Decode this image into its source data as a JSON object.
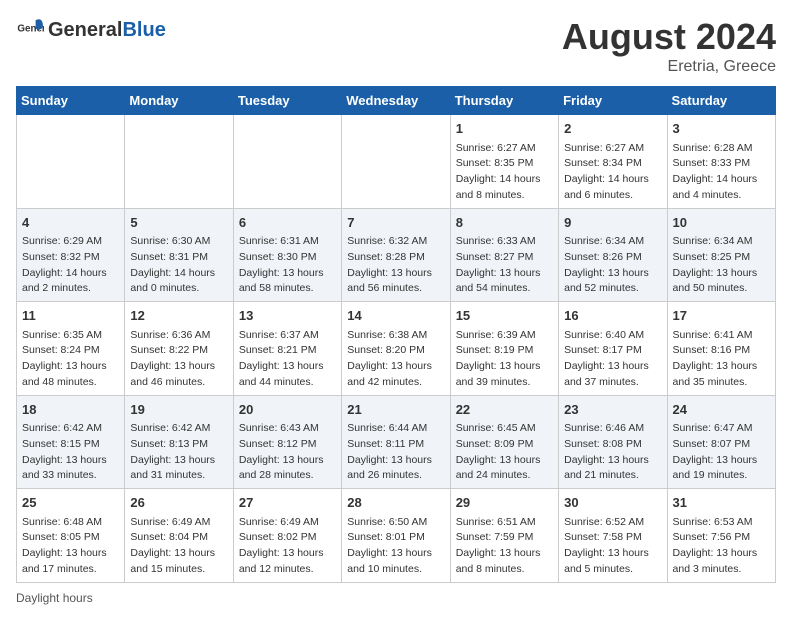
{
  "logo": {
    "general": "General",
    "blue": "Blue"
  },
  "title": "August 2024",
  "location": "Eretria, Greece",
  "days_of_week": [
    "Sunday",
    "Monday",
    "Tuesday",
    "Wednesday",
    "Thursday",
    "Friday",
    "Saturday"
  ],
  "weeks": [
    [
      {
        "day": "",
        "content": ""
      },
      {
        "day": "",
        "content": ""
      },
      {
        "day": "",
        "content": ""
      },
      {
        "day": "",
        "content": ""
      },
      {
        "day": "1",
        "content": "Sunrise: 6:27 AM\nSunset: 8:35 PM\nDaylight: 14 hours and 8 minutes."
      },
      {
        "day": "2",
        "content": "Sunrise: 6:27 AM\nSunset: 8:34 PM\nDaylight: 14 hours and 6 minutes."
      },
      {
        "day": "3",
        "content": "Sunrise: 6:28 AM\nSunset: 8:33 PM\nDaylight: 14 hours and 4 minutes."
      }
    ],
    [
      {
        "day": "4",
        "content": "Sunrise: 6:29 AM\nSunset: 8:32 PM\nDaylight: 14 hours and 2 minutes."
      },
      {
        "day": "5",
        "content": "Sunrise: 6:30 AM\nSunset: 8:31 PM\nDaylight: 14 hours and 0 minutes."
      },
      {
        "day": "6",
        "content": "Sunrise: 6:31 AM\nSunset: 8:30 PM\nDaylight: 13 hours and 58 minutes."
      },
      {
        "day": "7",
        "content": "Sunrise: 6:32 AM\nSunset: 8:28 PM\nDaylight: 13 hours and 56 minutes."
      },
      {
        "day": "8",
        "content": "Sunrise: 6:33 AM\nSunset: 8:27 PM\nDaylight: 13 hours and 54 minutes."
      },
      {
        "day": "9",
        "content": "Sunrise: 6:34 AM\nSunset: 8:26 PM\nDaylight: 13 hours and 52 minutes."
      },
      {
        "day": "10",
        "content": "Sunrise: 6:34 AM\nSunset: 8:25 PM\nDaylight: 13 hours and 50 minutes."
      }
    ],
    [
      {
        "day": "11",
        "content": "Sunrise: 6:35 AM\nSunset: 8:24 PM\nDaylight: 13 hours and 48 minutes."
      },
      {
        "day": "12",
        "content": "Sunrise: 6:36 AM\nSunset: 8:22 PM\nDaylight: 13 hours and 46 minutes."
      },
      {
        "day": "13",
        "content": "Sunrise: 6:37 AM\nSunset: 8:21 PM\nDaylight: 13 hours and 44 minutes."
      },
      {
        "day": "14",
        "content": "Sunrise: 6:38 AM\nSunset: 8:20 PM\nDaylight: 13 hours and 42 minutes."
      },
      {
        "day": "15",
        "content": "Sunrise: 6:39 AM\nSunset: 8:19 PM\nDaylight: 13 hours and 39 minutes."
      },
      {
        "day": "16",
        "content": "Sunrise: 6:40 AM\nSunset: 8:17 PM\nDaylight: 13 hours and 37 minutes."
      },
      {
        "day": "17",
        "content": "Sunrise: 6:41 AM\nSunset: 8:16 PM\nDaylight: 13 hours and 35 minutes."
      }
    ],
    [
      {
        "day": "18",
        "content": "Sunrise: 6:42 AM\nSunset: 8:15 PM\nDaylight: 13 hours and 33 minutes."
      },
      {
        "day": "19",
        "content": "Sunrise: 6:42 AM\nSunset: 8:13 PM\nDaylight: 13 hours and 31 minutes."
      },
      {
        "day": "20",
        "content": "Sunrise: 6:43 AM\nSunset: 8:12 PM\nDaylight: 13 hours and 28 minutes."
      },
      {
        "day": "21",
        "content": "Sunrise: 6:44 AM\nSunset: 8:11 PM\nDaylight: 13 hours and 26 minutes."
      },
      {
        "day": "22",
        "content": "Sunrise: 6:45 AM\nSunset: 8:09 PM\nDaylight: 13 hours and 24 minutes."
      },
      {
        "day": "23",
        "content": "Sunrise: 6:46 AM\nSunset: 8:08 PM\nDaylight: 13 hours and 21 minutes."
      },
      {
        "day": "24",
        "content": "Sunrise: 6:47 AM\nSunset: 8:07 PM\nDaylight: 13 hours and 19 minutes."
      }
    ],
    [
      {
        "day": "25",
        "content": "Sunrise: 6:48 AM\nSunset: 8:05 PM\nDaylight: 13 hours and 17 minutes."
      },
      {
        "day": "26",
        "content": "Sunrise: 6:49 AM\nSunset: 8:04 PM\nDaylight: 13 hours and 15 minutes."
      },
      {
        "day": "27",
        "content": "Sunrise: 6:49 AM\nSunset: 8:02 PM\nDaylight: 13 hours and 12 minutes."
      },
      {
        "day": "28",
        "content": "Sunrise: 6:50 AM\nSunset: 8:01 PM\nDaylight: 13 hours and 10 minutes."
      },
      {
        "day": "29",
        "content": "Sunrise: 6:51 AM\nSunset: 7:59 PM\nDaylight: 13 hours and 8 minutes."
      },
      {
        "day": "30",
        "content": "Sunrise: 6:52 AM\nSunset: 7:58 PM\nDaylight: 13 hours and 5 minutes."
      },
      {
        "day": "31",
        "content": "Sunrise: 6:53 AM\nSunset: 7:56 PM\nDaylight: 13 hours and 3 minutes."
      }
    ]
  ],
  "footer": "Daylight hours"
}
